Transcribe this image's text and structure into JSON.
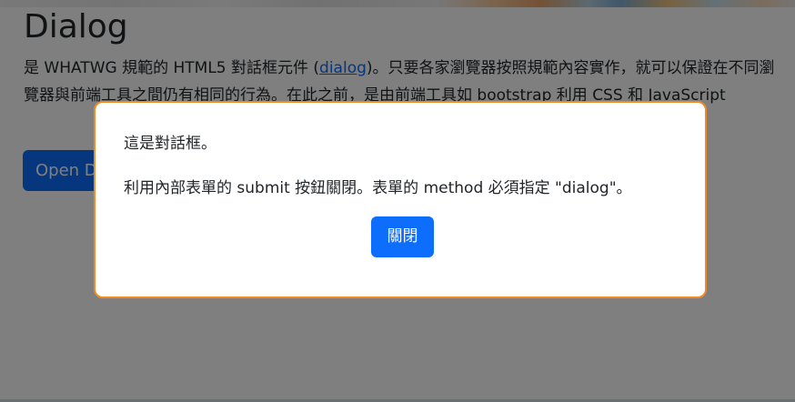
{
  "page": {
    "title": "Dialog",
    "intro_before_link": "是 WHATWG 規範的 HTML5 對話框元件 (",
    "intro_link": "dialog",
    "intro_after_link": ")。只要各家瀏覽器按照規範內容實作，就可以保證在不同瀏覽器與前端工具之間仍有相同的行為。在此之前，是由前端工具如 bootstrap 利用 CSS 和 JavaScript",
    "open_button_label": "Open Dialog"
  },
  "dialog": {
    "line1": "這是對話框。",
    "line2": "利用內部表單的 submit 按鈕關閉。表單的 method 必須指定 \"dialog\"。",
    "close_button_label": "關閉"
  },
  "colors": {
    "primary": "#0d6efd",
    "dialog_border": "#f08a24",
    "backdrop": "rgba(0,0,0,0.5)"
  }
}
